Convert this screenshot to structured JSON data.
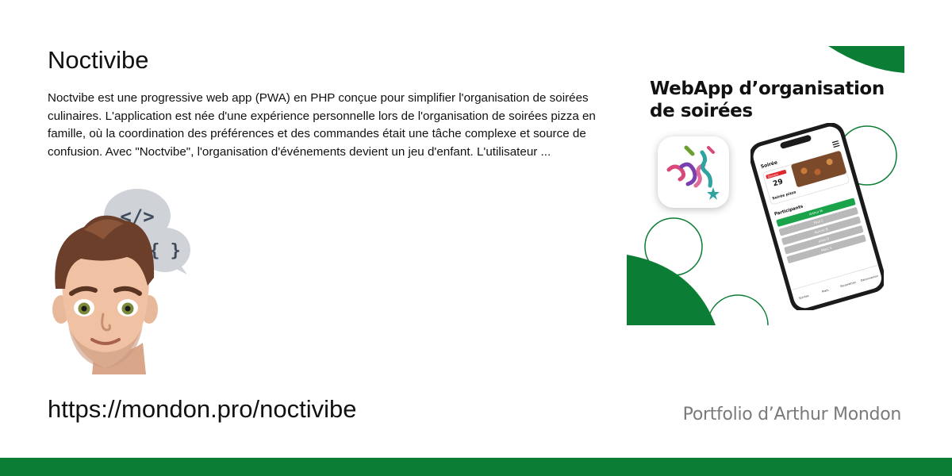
{
  "project": {
    "title": "Noctivibe",
    "description": "Noctvibe est une progressive web app (PWA) en PHP conçue pour simplifier l'organisation de soirées culinaires. L'application est née d'une expérience personnelle lors de l'organisation de soirées pizza en famille, où la coordination des préférences et des commandes était une tâche complexe et source de confusion.     Avec \"Noctvibe\", l'organisation d'événements devient un jeu d'enfant. L'utilisateur ...",
    "url": "https://mondon.pro/noctivibe"
  },
  "footer": {
    "signature": "Portfolio d’Arthur Mondon"
  },
  "promo": {
    "headline_line1": "WebApp d’organisation",
    "headline_line2": "de soirées"
  },
  "phone_app": {
    "header": "Soirée",
    "event_date_day": "29",
    "event_tag": "Demain",
    "event_title": "Soirée pizza",
    "participants_heading": "Participants",
    "participants": [
      "Arthur M",
      "Paul C",
      "Aurore B",
      "Jules D",
      "Marc S"
    ],
    "nav": [
      "Soirées",
      "Plats",
      "Paramètres",
      "Déconnexion"
    ]
  },
  "colors": {
    "brand_green": "#0c7d35",
    "text_dark": "#111111",
    "signature_gray": "#7a7a7a"
  },
  "icons": [
    "memoji-avatar",
    "code-bracket-bubble-icon",
    "curly-brace-bubble-icon",
    "confetti-app-icon"
  ]
}
